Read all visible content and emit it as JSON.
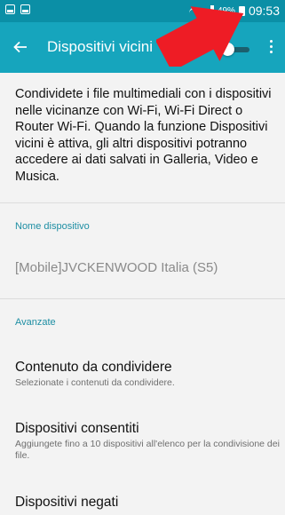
{
  "status_bar": {
    "battery_percent": "49%",
    "time": "09:53"
  },
  "toolbar": {
    "back_icon": "arrow-left-icon",
    "title": "Dispositivi vicini",
    "toggle_state": "off",
    "more_icon": "more-vert-icon"
  },
  "description": "Condividete i file multimediali con i dispositivi nelle vicinanze con Wi-Fi, Wi-Fi Direct o Router Wi-Fi. Quando la funzione Dispositivi vicini è attiva, gli altri dispositivi potranno accedere ai dati salvati in Galleria, Video e Musica.",
  "device_section": {
    "label": "Nome dispositivo",
    "value": "[Mobile]JVCKENWOOD Italia (S5)"
  },
  "advanced_section": {
    "label": "Avanzate",
    "items": [
      {
        "title": "Contenuto da condividere",
        "subtitle": "Selezionate i contenuti da condividere."
      },
      {
        "title": "Dispositivi consentiti",
        "subtitle": "Aggiungete fino a 10 dispositivi all'elenco per la condivisione dei file."
      },
      {
        "title": "Dispositivi negati",
        "subtitle": ""
      }
    ]
  },
  "colors": {
    "status_bar": "#0b8fa6",
    "toolbar": "#16a5bd",
    "background": "#f3f3f3",
    "section_label": "#1d8ea3",
    "annotation_arrow": "#ee1c25"
  }
}
